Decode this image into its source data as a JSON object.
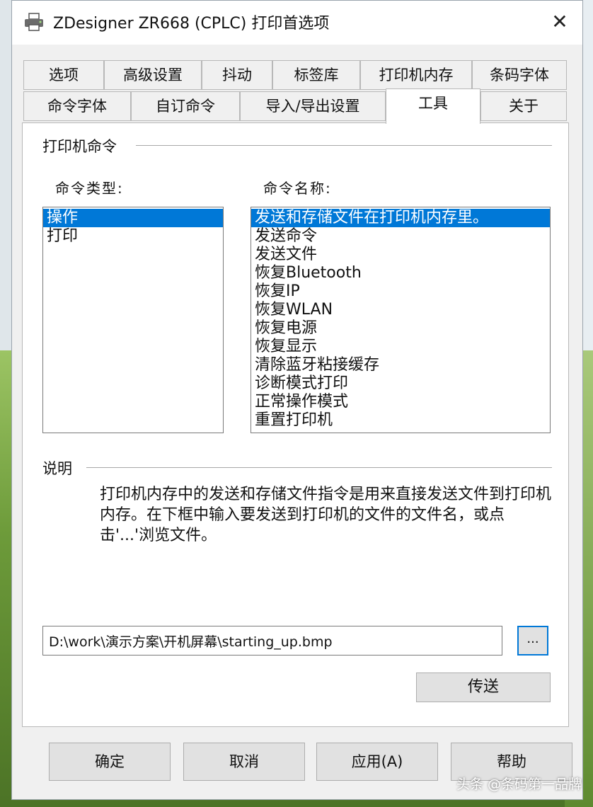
{
  "window": {
    "title": "ZDesigner ZR668 (CPLC) 打印首选项",
    "close_glyph": "✕"
  },
  "tabs_row1": [
    "选项",
    "高级设置",
    "抖动",
    "标签库",
    "打印机内存",
    "条码字体"
  ],
  "tabs_row2": [
    "命令字体",
    "自订命令",
    "导入/导出设置",
    "工具",
    "关于"
  ],
  "active_tab": "工具",
  "printer_commands": {
    "group_label": "打印机命令",
    "type_label": "命令类型:",
    "name_label": "命令名称:",
    "types": [
      "操作",
      "打印"
    ],
    "selected_type": "操作",
    "names": [
      "发送和存储文件在打印机内存里。",
      "发送命令",
      "发送文件",
      "恢复Bluetooth",
      "恢复IP",
      "恢复WLAN",
      "恢复电源",
      "恢复显示",
      "清除蓝牙粘接缓存",
      "诊断模式打印",
      "正常操作模式",
      "重置打印机"
    ],
    "selected_name": "发送和存储文件在打印机内存里。"
  },
  "description": {
    "group_label": "说明",
    "text": "打印机内存中的发送和存储文件指令是用来直接发送文件到打印机内存。在下框中输入要发送到打印机的文件的文件名，或点击'...'浏览文件。"
  },
  "file": {
    "path": "D:\\work\\演示方案\\开机屏幕\\starting_up.bmp",
    "browse_label": "...",
    "send_label": "传送"
  },
  "buttons": {
    "ok": "确定",
    "cancel": "取消",
    "apply": "应用(A)",
    "help": "帮助"
  },
  "watermark": "头条 @条码第一品牌",
  "colors": {
    "selection": "#0078d7",
    "focus_border": "#0078d7"
  },
  "icons": {
    "title": "printer-icon",
    "close": "close-icon"
  }
}
